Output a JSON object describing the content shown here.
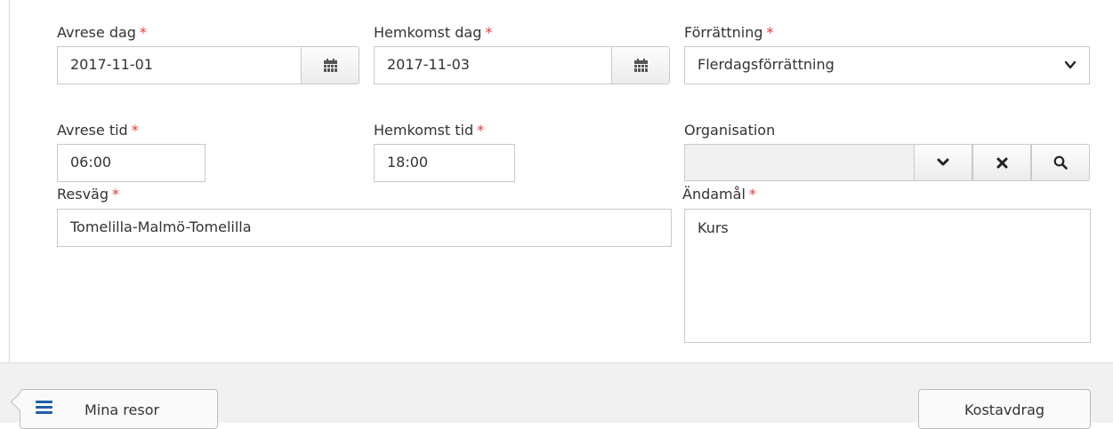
{
  "form": {
    "departure_date": {
      "label": "Avrese dag",
      "required_mark": "*",
      "value": "2017-11-01"
    },
    "return_date": {
      "label": "Hemkomst dag",
      "required_mark": "*",
      "value": "2017-11-03"
    },
    "assignment": {
      "label": "Förrättning",
      "required_mark": "*",
      "value": "Flerdagsförrättning"
    },
    "departure_time": {
      "label": "Avrese tid",
      "required_mark": "*",
      "value": "06:00"
    },
    "return_time": {
      "label": "Hemkomst tid",
      "required_mark": "*",
      "value": "18:00"
    },
    "organisation": {
      "label": "Organisation",
      "value": ""
    },
    "route": {
      "label": "Resväg",
      "required_mark": "*",
      "value": "Tomelilla-Malmö-Tomelilla"
    },
    "purpose": {
      "label": "Ändamål",
      "required_mark": "*",
      "value": "Kurs"
    }
  },
  "footer": {
    "back_label": "Mina resor",
    "next_label": "Kostavdrag"
  },
  "colors": {
    "required": "#e53935",
    "accent": "#1f5fa8"
  },
  "icons": [
    "calendar-icon",
    "chevron-down-icon",
    "close-icon",
    "search-icon",
    "menu-icon"
  ]
}
